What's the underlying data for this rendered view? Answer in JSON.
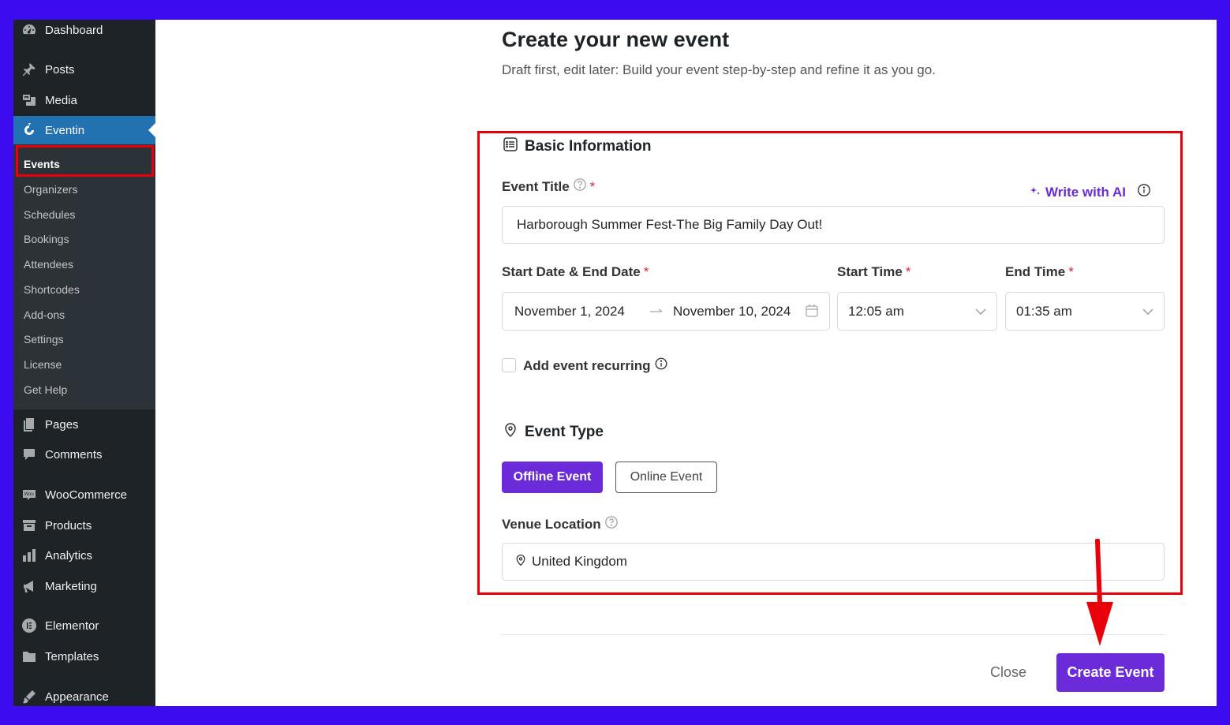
{
  "sidebar": {
    "top_items": [
      {
        "label": "Dashboard",
        "icon": "dashboard-icon"
      },
      {
        "label": "Posts",
        "icon": "pin-icon"
      },
      {
        "label": "Media",
        "icon": "media-icon"
      },
      {
        "label": "Eventin",
        "icon": "eventin-icon"
      }
    ],
    "submenu": [
      "Events",
      "Organizers",
      "Schedules",
      "Bookings",
      "Attendees",
      "Shortcodes",
      "Add-ons",
      "Settings",
      "License",
      "Get Help"
    ],
    "bottom_items": [
      {
        "label": "Pages",
        "icon": "pages-icon"
      },
      {
        "label": "Comments",
        "icon": "comment-icon"
      },
      {
        "label": "WooCommerce",
        "icon": "woocommerce-icon"
      },
      {
        "label": "Products",
        "icon": "archive-icon"
      },
      {
        "label": "Analytics",
        "icon": "bar-chart-icon"
      },
      {
        "label": "Marketing",
        "icon": "megaphone-icon"
      },
      {
        "label": "Elementor",
        "icon": "elementor-icon"
      },
      {
        "label": "Templates",
        "icon": "folder-icon"
      },
      {
        "label": "Appearance",
        "icon": "brush-icon"
      }
    ]
  },
  "header": {
    "title": "Create your new event",
    "subtitle": "Draft first, edit later: Build your event step-by-step and refine it as you go."
  },
  "basic_info": {
    "heading": "Basic Information",
    "event_title_label": "Event Title",
    "required_mark": "*",
    "write_ai_label": "Write with AI",
    "event_title_value": "Harborough Summer Fest-The Big Family Day Out!",
    "date_label": "Start Date & End Date",
    "start_date": "November 1, 2024",
    "end_date": "November 10, 2024",
    "start_time_label": "Start Time",
    "start_time_value": "12:05 am",
    "end_time_label": "End Time",
    "end_time_value": "01:35 am",
    "recurring_label": "Add event recurring"
  },
  "event_type": {
    "heading": "Event Type",
    "offline_label": "Offline Event",
    "online_label": "Online Event",
    "venue_label": "Venue Location",
    "venue_value": "United Kingdom"
  },
  "footer": {
    "close_label": "Close",
    "create_label": "Create Event"
  },
  "colors": {
    "accent": "#6b2bd9",
    "wp_sidebar": "#1d2327",
    "wp_active": "#2271b1",
    "highlight": "#e8000b",
    "frame": "#3d0bf0"
  }
}
